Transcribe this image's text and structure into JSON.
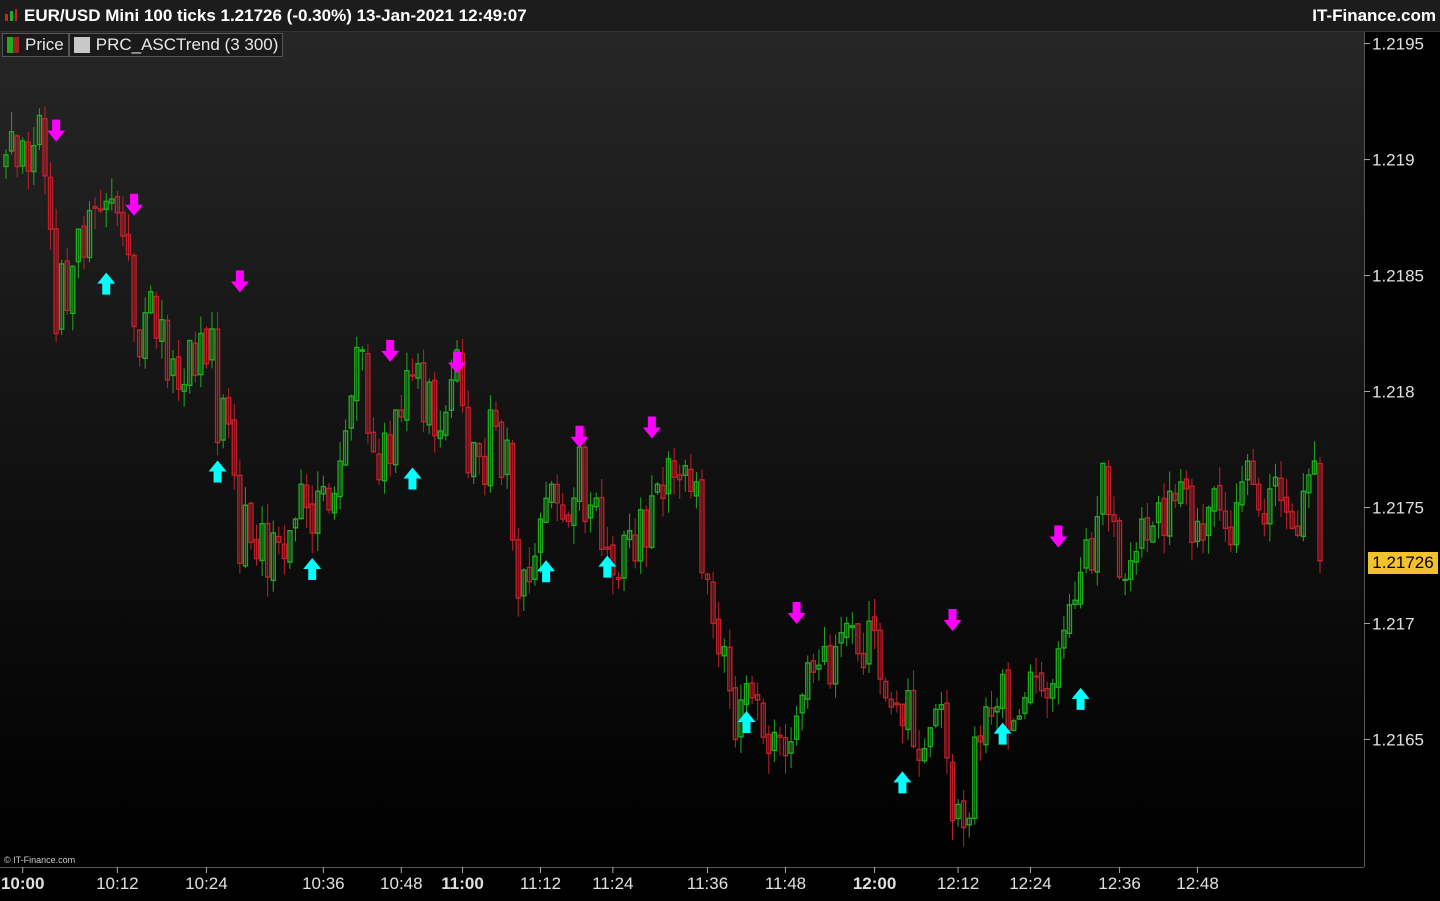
{
  "header": {
    "title": "EUR/USD Mini 100 ticks 1.21726 (-0.30%) 13-Jan-2021 12:49:07",
    "brand": "IT-Finance.com"
  },
  "legend": {
    "price_label": "Price",
    "indicator_label": "PRC_ASCTrend (3 300)"
  },
  "copyright": "© IT-Finance.com",
  "last_price": "1.21726",
  "colors": {
    "up": "#1faa1f",
    "down": "#c0202a",
    "buy_arrow": "#00ffff",
    "sell_arrow": "#ff00ff",
    "price_tag": "#f2c12e"
  },
  "chart_data": {
    "type": "candlestick",
    "ylim": [
      1.21595,
      1.21955
    ],
    "y_ticks": [
      "1.2195",
      "1.219",
      "1.2185",
      "1.218",
      "1.2175",
      "1.217",
      "1.2165"
    ],
    "x_ticks": [
      {
        "label": "10:00",
        "index": 3,
        "bold": true
      },
      {
        "label": "10:12",
        "index": 20,
        "bold": false
      },
      {
        "label": "10:24",
        "index": 36,
        "bold": false
      },
      {
        "label": "10:36",
        "index": 57,
        "bold": false
      },
      {
        "label": "10:48",
        "index": 71,
        "bold": false
      },
      {
        "label": "11:00",
        "index": 82,
        "bold": true
      },
      {
        "label": "11:12",
        "index": 96,
        "bold": false
      },
      {
        "label": "11:24",
        "index": 109,
        "bold": false
      },
      {
        "label": "11:36",
        "index": 126,
        "bold": false
      },
      {
        "label": "11:48",
        "index": 140,
        "bold": false
      },
      {
        "label": "12:00",
        "index": 156,
        "bold": true
      },
      {
        "label": "12:12",
        "index": 171,
        "bold": false
      },
      {
        "label": "12:24",
        "index": 184,
        "bold": false
      },
      {
        "label": "12:36",
        "index": 200,
        "bold": false
      },
      {
        "label": "12:48",
        "index": 214,
        "bold": false
      }
    ],
    "closes": [
      1.21902,
      1.21912,
      1.21897,
      1.21908,
      1.21895,
      1.21906,
      1.21919,
      1.21893,
      1.2187,
      1.21825,
      1.21855,
      1.21835,
      1.21854,
      1.2187,
      1.21858,
      1.21878,
      1.21879,
      1.21878,
      1.21882,
      1.21883,
      1.21877,
      1.21867,
      1.21859,
      1.21828,
      1.21815,
      1.21834,
      1.21843,
      1.21823,
      1.21831,
      1.21805,
      1.21814,
      1.21801,
      1.21803,
      1.21822,
      1.21807,
      1.21825,
      1.21812,
      1.21827,
      1.21778,
      1.21797,
      1.21786,
      1.21764,
      1.21726,
      1.21751,
      1.21735,
      1.21728,
      1.21743,
      1.2172,
      1.21739,
      1.21735,
      1.21728,
      1.2174,
      1.21745,
      1.2176,
      1.2175,
      1.21739,
      1.21757,
      1.21759,
      1.21749,
      1.21756,
      1.2177,
      1.21783,
      1.21798,
      1.21819,
      1.21818,
      1.21782,
      1.21774,
      1.21762,
      1.21782,
      1.21769,
      1.21792,
      1.21789,
      1.21809,
      1.21807,
      1.21812,
      1.21787,
      1.21804,
      1.21781,
      1.21783,
      1.21791,
      1.21805,
      1.21818,
      1.21794,
      1.21765,
      1.21778,
      1.21772,
      1.2176,
      1.21792,
      1.21785,
      1.21763,
      1.21779,
      1.21736,
      1.21711,
      1.21723,
      1.21718,
      1.21729,
      1.21745,
      1.21754,
      1.2176,
      1.21752,
      1.21745,
      1.21744,
      1.21754,
      1.21776,
      1.21744,
      1.21751,
      1.21754,
      1.21732,
      1.21732,
      1.21721,
      1.21719,
      1.21738,
      1.2174,
      1.21727,
      1.21749,
      1.21733,
      1.21755,
      1.2176,
      1.21754,
      1.21771,
      1.21763,
      1.21762,
      1.21768,
      1.21757,
      1.21761,
      1.21722,
      1.21719,
      1.217,
      1.21687,
      1.2169,
      1.21671,
      1.2165,
      1.21667,
      1.21674,
      1.21668,
      1.21667,
      1.21651,
      1.21644,
      1.21653,
      1.21651,
      1.21643,
      1.21649,
      1.2166,
      1.21669,
      1.21683,
      1.21679,
      1.21682,
      1.2169,
      1.21674,
      1.2169,
      1.21696,
      1.217,
      1.21699,
      1.21687,
      1.21681,
      1.21701,
      1.21697,
      1.21676,
      1.21668,
      1.21664,
      1.21665,
      1.21656,
      1.21671,
      1.21647,
      1.21641,
      1.21646,
      1.21655,
      1.21663,
      1.21665,
      1.21642,
      1.21615,
      1.21622,
      1.21612,
      1.21616,
      1.21651,
      1.21649,
      1.21664,
      1.2166,
      1.21664,
      1.21678,
      1.21654,
      1.21658,
      1.2166,
      1.21668,
      1.21679,
      1.21677,
      1.21671,
      1.21668,
      1.21674,
      1.21689,
      1.21697,
      1.21708,
      1.2171,
      1.21722,
      1.21736,
      1.21723,
      1.21746,
      1.21769,
      1.21747,
      1.21744,
      1.2172,
      1.21719,
      1.21727,
      1.21731,
      1.21745,
      1.21736,
      1.21742,
      1.21752,
      1.21738,
      1.21757,
      1.21753,
      1.21761,
      1.21758,
      1.21735,
      1.21744,
      1.21736,
      1.2175,
      1.21758,
      1.21749,
      1.21741,
      1.21734,
      1.21752,
      1.21761,
      1.2177,
      1.2176,
      1.21749,
      1.21743,
      1.21758,
      1.21763,
      1.21753,
      1.21748,
      1.21741,
      1.21738,
      1.21757,
      1.21764,
      1.2177,
      1.21727
    ],
    "buy_signals": [
      {
        "index": 18,
        "price": 1.21859
      },
      {
        "index": 38,
        "price": 1.21778
      },
      {
        "index": 55,
        "price": 1.21736
      },
      {
        "index": 73,
        "price": 1.21775
      },
      {
        "index": 97,
        "price": 1.21735
      },
      {
        "index": 108,
        "price": 1.21737
      },
      {
        "index": 133,
        "price": 1.2167
      },
      {
        "index": 161,
        "price": 1.21644
      },
      {
        "index": 179,
        "price": 1.21665
      },
      {
        "index": 193,
        "price": 1.2168
      }
    ],
    "sell_signals": [
      {
        "index": 9,
        "price": 1.219
      },
      {
        "index": 23,
        "price": 1.21868
      },
      {
        "index": 42,
        "price": 1.21835
      },
      {
        "index": 69,
        "price": 1.21805
      },
      {
        "index": 81,
        "price": 1.218
      },
      {
        "index": 103,
        "price": 1.21768
      },
      {
        "index": 116,
        "price": 1.21772
      },
      {
        "index": 142,
        "price": 1.21692
      },
      {
        "index": 170,
        "price": 1.21689
      },
      {
        "index": 189,
        "price": 1.21725
      }
    ]
  }
}
